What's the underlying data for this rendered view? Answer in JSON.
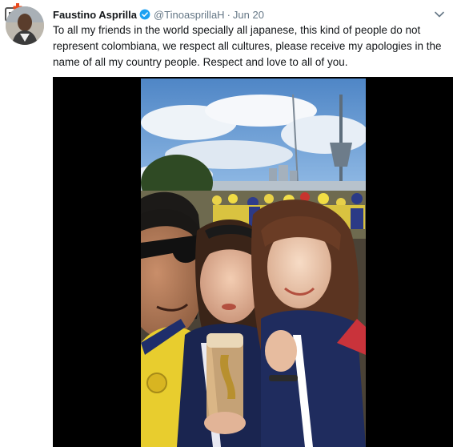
{
  "tweet": {
    "display_name": "Faustino Asprilla",
    "handle": "@TinoasprillaH",
    "separator": "·",
    "date": "Jun 20",
    "text": "To all my friends in the world specially all japanese, this kind of people do not represent colombiana, we respect all cultures, please receive my apologies in the name of all my country people. Respect and love to all of you.",
    "verified": true
  },
  "icons": {
    "verified": "verified-badge-icon",
    "caret": "chevron-down-icon",
    "watermark": "site-watermark-icon",
    "avatar": "profile-avatar"
  },
  "colors": {
    "accent": "#1da1f2",
    "text": "#14171a",
    "muted": "#657786",
    "watermark": "#e8491d"
  },
  "media": {
    "type": "video-still"
  }
}
